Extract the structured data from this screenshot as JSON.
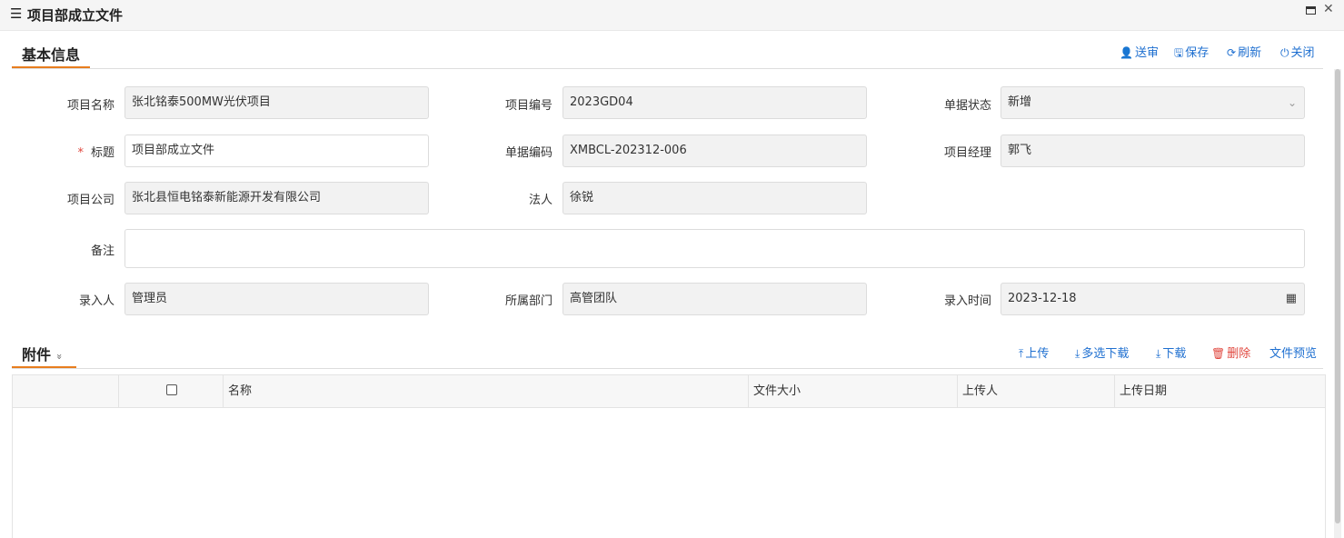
{
  "window": {
    "menu_icon": "menu-icon",
    "title": "项目部成立文件",
    "maximize_icon": "maximize-icon",
    "close_label": "✕"
  },
  "basic": {
    "title": "基本信息",
    "actions": {
      "submit": "送审",
      "save": "保存",
      "refresh": "刷新",
      "close": "关闭"
    },
    "fields": {
      "project_name_label": "项目名称",
      "project_name": "张北铭泰500MW光伏项目",
      "project_code_label": "项目编号",
      "project_code": "2023GD04",
      "doc_status_label": "单据状态",
      "doc_status": "新增",
      "title_required": "*",
      "title_label": "标题",
      "title_value": "项目部成立文件",
      "doc_code_label": "单据编码",
      "doc_code": "XMBCL-202312-006",
      "pm_label": "项目经理",
      "pm": "郭飞",
      "company_label": "项目公司",
      "company": "张北县恒电铭泰新能源开发有限公司",
      "legal_label": "法人",
      "legal": "徐锐",
      "remark_label": "备注",
      "remark": "",
      "entered_by_label": "录入人",
      "entered_by": "管理员",
      "dept_label": "所属部门",
      "dept": "高管团队",
      "entered_time_label": "录入时间",
      "entered_time": "2023-12-18"
    }
  },
  "attachments": {
    "title": "附件",
    "collapse_glyph": "»",
    "actions": {
      "upload": "上传",
      "multi_download": "多选下载",
      "download": "下载",
      "delete": "删除",
      "preview": "文件预览"
    },
    "columns": [
      "",
      "",
      "名称",
      "文件大小",
      "上传人",
      "上传日期"
    ]
  },
  "colors": {
    "accent": "#1e6fd0",
    "danger": "#e0463d",
    "tab_underline": "#e87d1e"
  }
}
